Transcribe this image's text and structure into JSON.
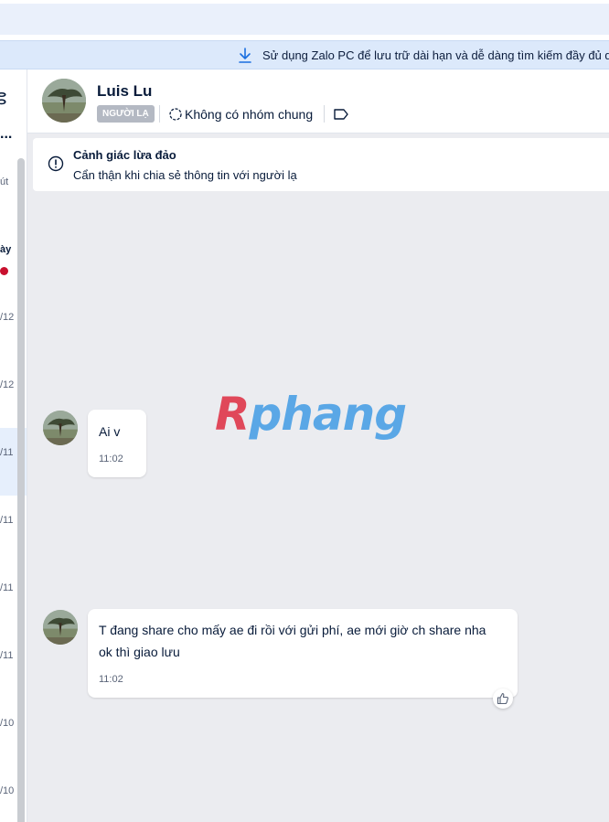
{
  "banner": {
    "icon": "download-icon",
    "text": "Sử dụng Zalo PC để lưu trữ dài hạn và dễ dàng tìm kiếm đầy đủ dữ"
  },
  "sidebar": {
    "edge_labels": [
      "út",
      "ày",
      "/12",
      "/12",
      "/11",
      "/11",
      "/11",
      "/11",
      "/10",
      "/10"
    ],
    "more": "..."
  },
  "header": {
    "name": "Luis Lu",
    "stranger_tag": "NGƯỜI LẠ",
    "group_text": "Không có nhóm chung",
    "icons": [
      "group-icon",
      "label-tag-icon"
    ]
  },
  "warning": {
    "icon": "alert-circle-icon",
    "title": "Cảnh giác lừa đảo",
    "subtitle": "Cẩn thận khi chia sẻ thông tin với người lạ"
  },
  "watermark": {
    "first": "R",
    "rest": "phang"
  },
  "messages": [
    {
      "lines": [
        "Ai v"
      ],
      "time": "11:02"
    },
    {
      "lines": [
        "T đang share cho mấy ae đi rồi với gửi phí, ae mới giờ ch share nha",
        "ok thì giao lưu"
      ],
      "time": "11:02",
      "reaction_icon": "thumbs-up-icon"
    }
  ]
}
